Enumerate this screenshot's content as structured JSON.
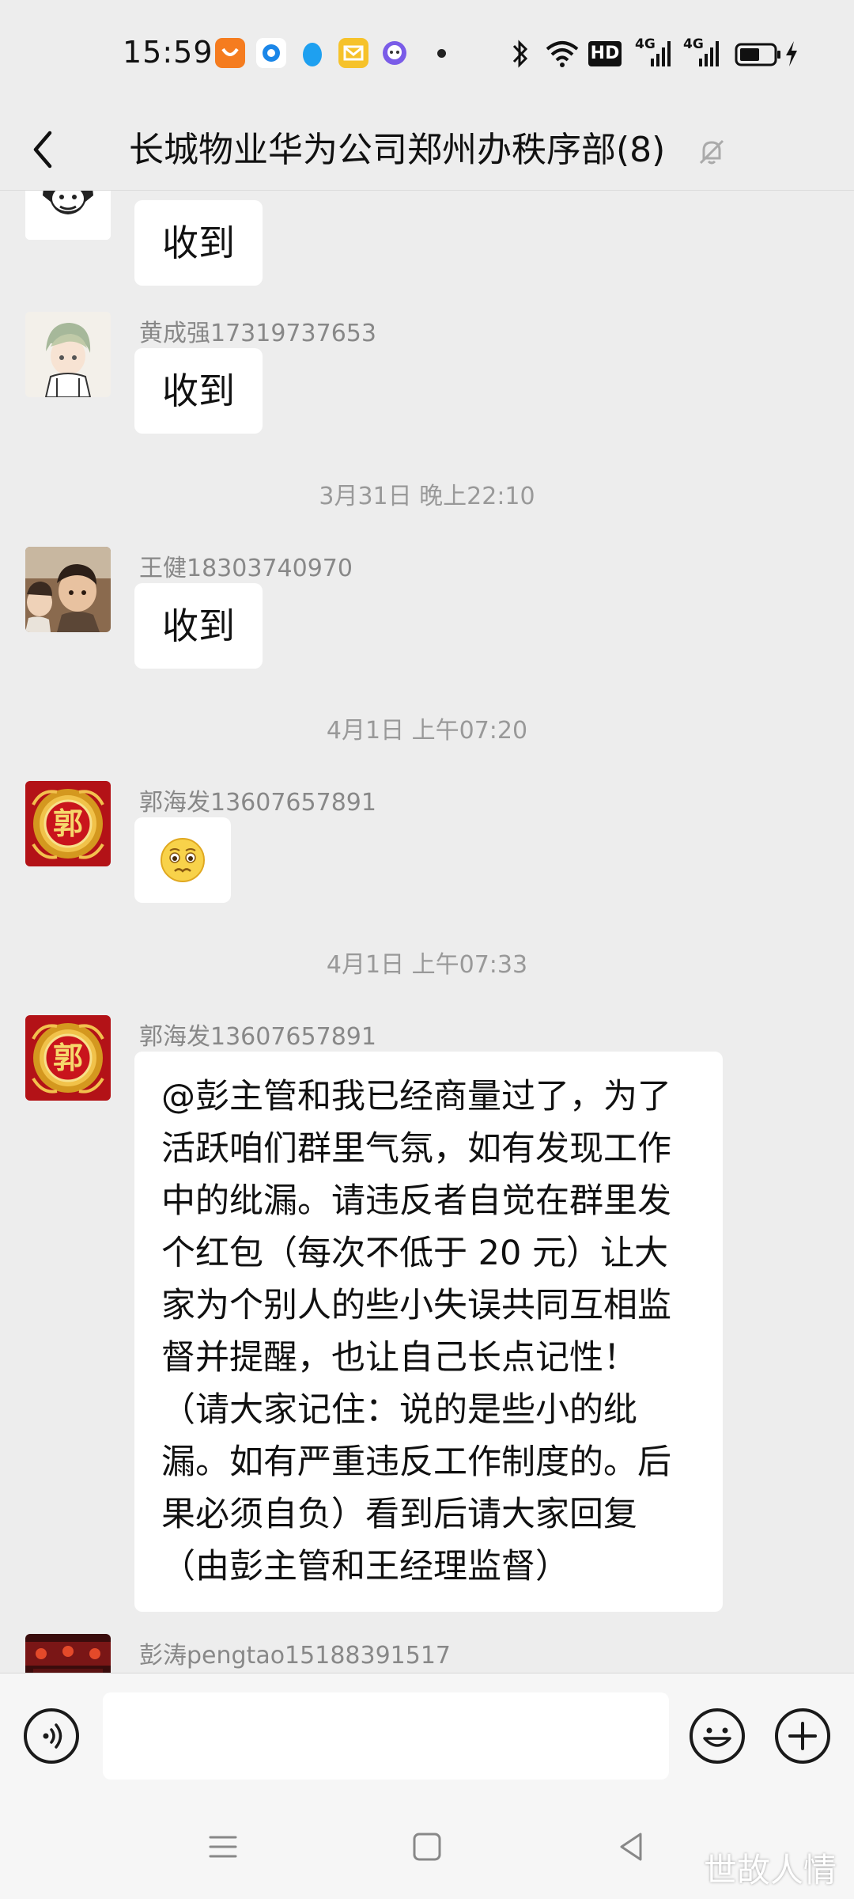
{
  "status_bar": {
    "time": "15:59",
    "icons": [
      "uc-browser-icon",
      "blue-app-icon",
      "qq-penguin-icon",
      "mail-icon",
      "assistant-icon",
      "dot-icon",
      "bluetooth-icon",
      "wifi-icon",
      "hd-icon",
      "signal-4g-icon",
      "signal-4g-icon",
      "battery-icon",
      "charging-icon"
    ],
    "hd_label": "HD",
    "net_label": "4G"
  },
  "header": {
    "title": "长城物业华为公司郑州办秩序部(8)"
  },
  "chat": {
    "messages": [
      {
        "type": "text",
        "sender": "",
        "text": "收到"
      },
      {
        "type": "text",
        "sender": "黄成强17319737653",
        "text": "收到"
      },
      {
        "type": "time",
        "text": "3月31日 晚上22:10"
      },
      {
        "type": "text",
        "sender": "王健18303740970",
        "text": "收到"
      },
      {
        "type": "time",
        "text": "4月1日 上午07:20"
      },
      {
        "type": "emoji",
        "sender": "郭海发13607657891",
        "text": ""
      },
      {
        "type": "time",
        "text": "4月1日 上午07:33"
      },
      {
        "type": "text",
        "sender": "郭海发13607657891",
        "text": "@彭主管和我已经商量过了，为了活跃咱们群里气氛，如有发现工作中的纰漏。请违反者自觉在群里发个红包（每次不低于 20 元）让大家为个别人的些小失误共同互相监督并提醒，也让自己长点记性！（请大家记住：说的是些小的纰漏。如有严重违反工作制度的。后果必须自负）看到后请大家回复（由彭主管和王经理监督）"
      },
      {
        "type": "text",
        "sender": "彭涛pengtao15188391517",
        "text": ""
      }
    ],
    "avatar_char": "郭"
  },
  "input_bar": {
    "placeholder": ""
  },
  "watermark": "世故人情",
  "colors": {
    "background": "#ededed",
    "bubble": "#ffffff",
    "sender": "#888888",
    "timestamp": "#999999",
    "avatar_red": "#c0161b",
    "avatar_gold": "#f2c14e"
  }
}
